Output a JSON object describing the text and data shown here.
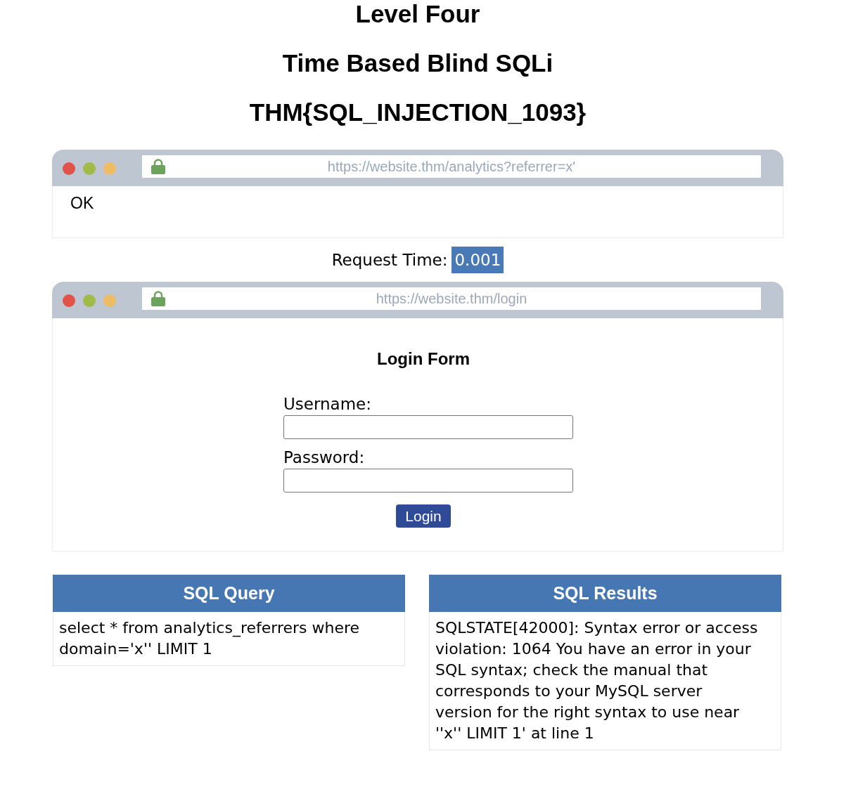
{
  "headings": [
    "Level Four",
    "Time Based Blind SQLi",
    "THM{SQL_INJECTION_1093}"
  ],
  "analytics_window": {
    "url": "https://website.thm/analytics?referrer=x'",
    "response": "OK"
  },
  "request_time": {
    "label": "Request Time:",
    "value": "0.001"
  },
  "login_window": {
    "url": "https://website.thm/login",
    "form": {
      "title": "Login Form",
      "fields": [
        {
          "label": "Username:"
        },
        {
          "label": "Password:"
        }
      ],
      "button": "Login"
    }
  },
  "panels": [
    {
      "title": "SQL Query",
      "text": "select * from analytics_referrers where domain='x'' LIMIT 1"
    },
    {
      "title": "SQL Results",
      "text": "SQLSTATE[42000]: Syntax error or access violation: 1064 You have an error in your SQL syntax; check the manual that corresponds to your MySQL server version for the right syntax to use near ''x'' LIMIT 1' at line 1"
    }
  ]
}
